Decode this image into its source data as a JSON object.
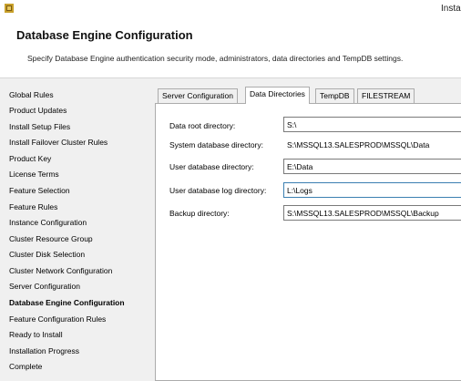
{
  "window": {
    "title": "Insta"
  },
  "header": {
    "title": "Database Engine Configuration",
    "description": "Specify Database Engine authentication security mode, administrators, data directories and TempDB settings."
  },
  "sidebar": {
    "items": [
      {
        "label": "Global Rules"
      },
      {
        "label": "Product Updates"
      },
      {
        "label": "Install Setup Files"
      },
      {
        "label": "Install Failover Cluster Rules"
      },
      {
        "label": "Product Key"
      },
      {
        "label": "License Terms"
      },
      {
        "label": "Feature Selection"
      },
      {
        "label": "Feature Rules"
      },
      {
        "label": "Instance Configuration"
      },
      {
        "label": "Cluster Resource Group"
      },
      {
        "label": "Cluster Disk Selection"
      },
      {
        "label": "Cluster Network Configuration"
      },
      {
        "label": "Server Configuration"
      },
      {
        "label": "Database Engine Configuration",
        "active": true
      },
      {
        "label": "Feature Configuration Rules"
      },
      {
        "label": "Ready to Install"
      },
      {
        "label": "Installation Progress"
      },
      {
        "label": "Complete"
      }
    ]
  },
  "tabs": [
    {
      "label": "Server Configuration"
    },
    {
      "label": "Data Directories",
      "active": true
    },
    {
      "label": "TempDB"
    },
    {
      "label": "FILESTREAM"
    }
  ],
  "data_directories": {
    "data_root_label": "Data root directory:",
    "data_root_value": "S:\\",
    "system_db_label": "System database directory:",
    "system_db_value": "S:\\MSSQL13.SALESPROD\\MSSQL\\Data",
    "user_db_label": "User database directory:",
    "user_db_value": "E:\\Data",
    "user_db_log_label": "User database log directory:",
    "user_db_log_value": "L:\\Logs",
    "backup_label": "Backup directory:",
    "backup_value": "S:\\MSSQL13.SALESPROD\\MSSQL\\Backup"
  }
}
